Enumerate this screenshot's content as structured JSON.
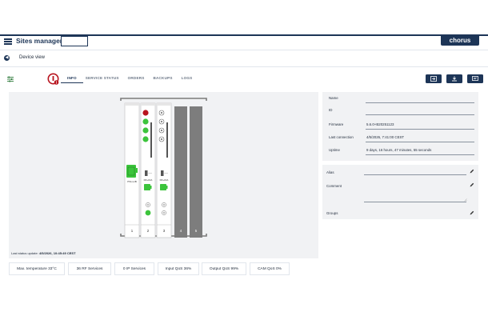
{
  "header": {
    "title": "Sites manager",
    "brand": "chorus"
  },
  "subheader": {
    "title": "Device view"
  },
  "tabs": [
    {
      "label": "INFO",
      "active": true
    },
    {
      "label": "SERVICE STATUS",
      "active": false
    },
    {
      "label": "ORDERS",
      "active": false
    },
    {
      "label": "BACKUPS",
      "active": false
    },
    {
      "label": "LOGS",
      "active": false
    }
  ],
  "rack": {
    "slot_numbers": [
      "1",
      "2",
      "3",
      "4",
      "5"
    ],
    "card_labels": [
      "PSU+1B",
      "RF+IDA",
      "RF+IDA"
    ],
    "status_update_label": "Last status update:",
    "status_update_value": "4/5/2026, 10:45:49 CEST"
  },
  "info": {
    "rows": [
      {
        "label": "Name",
        "value": ""
      },
      {
        "label": "ID",
        "value": ""
      },
      {
        "label": "Firmware",
        "value": "5.6.0+B20251123"
      },
      {
        "label": "Last connection",
        "value": "4/5/2026, 7:41:00 CEST"
      },
      {
        "label": "Uptime",
        "value": "9 days, 16 hours, 47 minutes, 55 seconds"
      }
    ]
  },
  "meta": {
    "alias_label": "Alias",
    "comment_label": "Comment",
    "groups_label": "Groups"
  },
  "stats": [
    "Max. temperature 33°C",
    "36 RF Services",
    "0 IP Services",
    "Input QoS 36%",
    "Output QoS 99%",
    "CAM QoS 0%"
  ],
  "colors": {
    "primary": "#1d3557",
    "accent_red": "#b8141e",
    "led_green": "#3cc43c",
    "panel_bg": "#f1f2f4"
  },
  "icons": {
    "menu": "hamburger-icon",
    "back": "arrow-left-icon",
    "filter": "sliders-icon",
    "device": "alarm-device-icon",
    "toolbar": [
      "import-icon",
      "download-icon",
      "message-icon"
    ],
    "edit": "pencil-icon"
  }
}
